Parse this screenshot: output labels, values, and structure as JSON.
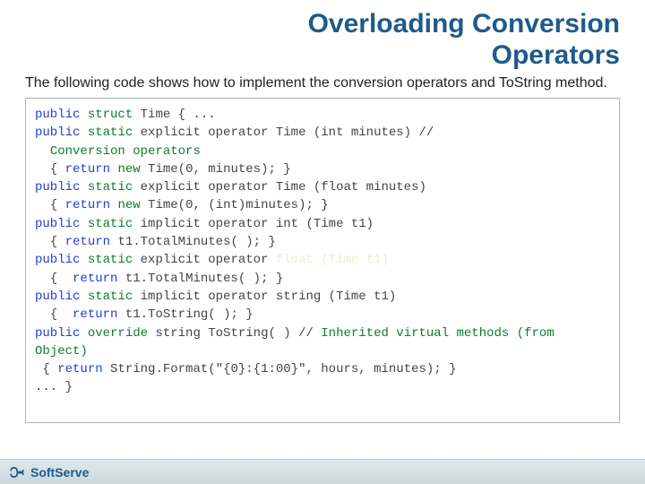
{
  "title_line1": "Overloading Conversion",
  "title_line2": "Operators",
  "intro": "The following code shows how to implement the conversion operators and ToString method.",
  "code": {
    "l1a": "public",
    "l1b": " struct",
    "l1c": " Time { ...",
    "l2a": "public",
    "l2b": " static",
    "l2c": " explicit operator Time (int minutes) // ",
    "l2d": "Conversion operators",
    "l3a": "{ ",
    "l3b": "return",
    "l3c": " new",
    "l3d": " Time(0, minutes); }",
    "l4a": "public",
    "l4b": " static",
    "l4c": " explicit operator Time (float minutes)",
    "l5a": "{ ",
    "l5b": "return",
    "l5c": " new",
    "l5d": " Time(0, (int)minutes); }",
    "l6a": "public",
    "l6b": " static",
    "l6c": " implicit operator int (Time t1)",
    "l7a": "{ ",
    "l7b": "return",
    "l7c": " t1.TotalMinutes( ); }",
    "l8a": "public",
    "l8b": " static",
    "l8c": " explicit operator ",
    "l8d": "float (Time t1)",
    "l9a": "{  ",
    "l9b": "return",
    "l9c": " t1.TotalMinutes( ); }",
    "l10a": "public",
    "l10b": " static",
    "l10c": " implicit operator string (Time t1)",
    "l11a": "{  ",
    "l11b": "return",
    "l11c": " t1.ToString( ); }",
    "l12a": "public",
    "l12b": " override",
    "l12c": " string ToString( ) // ",
    "l12d": "Inherited virtual methods (from Object)",
    "l13a": "{ ",
    "l13b": "return",
    "l13c": " String.Format(\"{0}:{1:00}\", hours, minutes); }",
    "l14": "... }"
  },
  "footer_brand": "SoftServe"
}
